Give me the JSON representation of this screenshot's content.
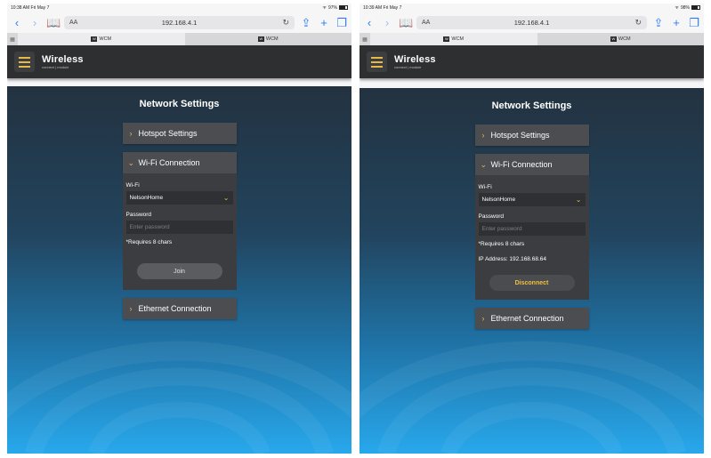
{
  "panels": {
    "left": {
      "status_time": "10:38 AM  Fri May 7",
      "status_battery": "97%",
      "url_aa": "AA",
      "url": "192.168.4.1",
      "tabs": [
        "WCM",
        "WCM"
      ],
      "brand_title": "Wireless",
      "brand_sub": "connect | module",
      "page_title": "Network Settings",
      "hotspot_label": "Hotspot Settings",
      "wifi_label": "Wi-Fi Connection",
      "wifi_field_label": "Wi-Fi",
      "wifi_selected": "NelsonHome",
      "password_label": "Password",
      "password_placeholder": "Enter password",
      "requirement_note": "*Requires 8 chars",
      "join_label": "Join",
      "ethernet_label": "Ethernet Connection"
    },
    "right": {
      "status_time": "10:39 AM  Fri May 7",
      "status_battery": "98%",
      "url_aa": "AA",
      "url": "192.168.4.1",
      "tabs": [
        "WCM",
        "WCM"
      ],
      "brand_title": "Wireless",
      "brand_sub": "connect | module",
      "page_title": "Network Settings",
      "hotspot_label": "Hotspot Settings",
      "wifi_label": "Wi-Fi Connection",
      "wifi_field_label": "Wi-Fi",
      "wifi_selected": "NelsonHome",
      "password_label": "Password",
      "password_placeholder": "Enter password",
      "requirement_note": "*Requires 8 chars",
      "ip_address": "IP Address:  192.168.68.64",
      "disconnect_label": "Disconnect",
      "ethernet_label": "Ethernet Connection"
    }
  },
  "icons": {
    "back": "chevron-left-icon",
    "forward": "chevron-right-icon",
    "bookmarks": "book-icon",
    "reload": "reload-icon",
    "share": "share-icon",
    "new_tab": "plus-icon",
    "tabs": "tabs-icon",
    "menu": "hamburger-menu-icon",
    "expand": "chevron-right-icon",
    "collapse": "chevron-down-icon"
  },
  "colors": {
    "accent": "#e6b94a",
    "header_bg": "#2e2f31",
    "safari_blue": "#2f7cf6",
    "gradient_top": "#233240",
    "gradient_bottom": "#28a8ec"
  }
}
